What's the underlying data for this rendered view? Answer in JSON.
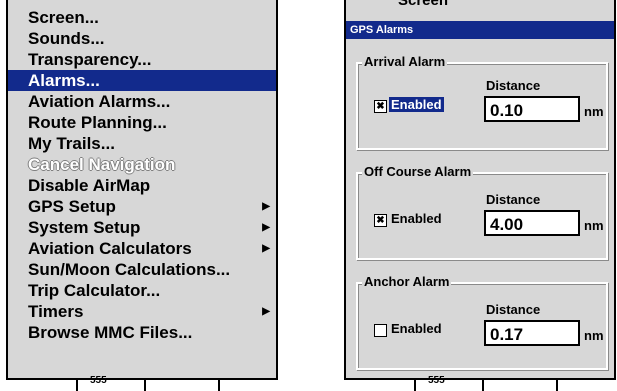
{
  "menu": {
    "items": [
      {
        "label": "Screen..."
      },
      {
        "label": "Sounds..."
      },
      {
        "label": "Transparency..."
      },
      {
        "label": "Alarms...",
        "selected": true
      },
      {
        "label": "Aviation Alarms..."
      },
      {
        "label": "Route Planning..."
      },
      {
        "label": "My Trails..."
      },
      {
        "label": "Cancel Navigation",
        "disabled": true
      },
      {
        "label": "Disable AirMap"
      },
      {
        "label": "GPS Setup",
        "submenu": true
      },
      {
        "label": "System Setup",
        "submenu": true
      },
      {
        "label": "Aviation Calculators",
        "submenu": true
      },
      {
        "label": "Sun/Moon Calculations..."
      },
      {
        "label": "Trip Calculator..."
      },
      {
        "label": "Timers",
        "submenu": true
      },
      {
        "label": "Browse MMC Files..."
      }
    ],
    "submenu_icon": "triangle-right-icon"
  },
  "bottom_strip": {
    "left_text": "555",
    "right_text": "555"
  },
  "dialog": {
    "behind_title": "Screen",
    "title": "GPS Alarms",
    "arrival": {
      "group_label": "Arrival Alarm",
      "distance_label": "Distance",
      "enabled_label": "Enabled",
      "enabled": true,
      "value": "0.10",
      "unit": "nm"
    },
    "off_course": {
      "group_label": "Off Course Alarm",
      "distance_label": "Distance",
      "enabled_label": "Enabled",
      "enabled": true,
      "value": "4.00",
      "unit": "nm"
    },
    "anchor": {
      "group_label": "Anchor Alarm",
      "distance_label": "Distance",
      "enabled_label": "Enabled",
      "enabled": false,
      "value": "0.17",
      "unit": "nm"
    }
  },
  "colors": {
    "selection": "#122a8c",
    "panel": "#d7d7d7"
  }
}
